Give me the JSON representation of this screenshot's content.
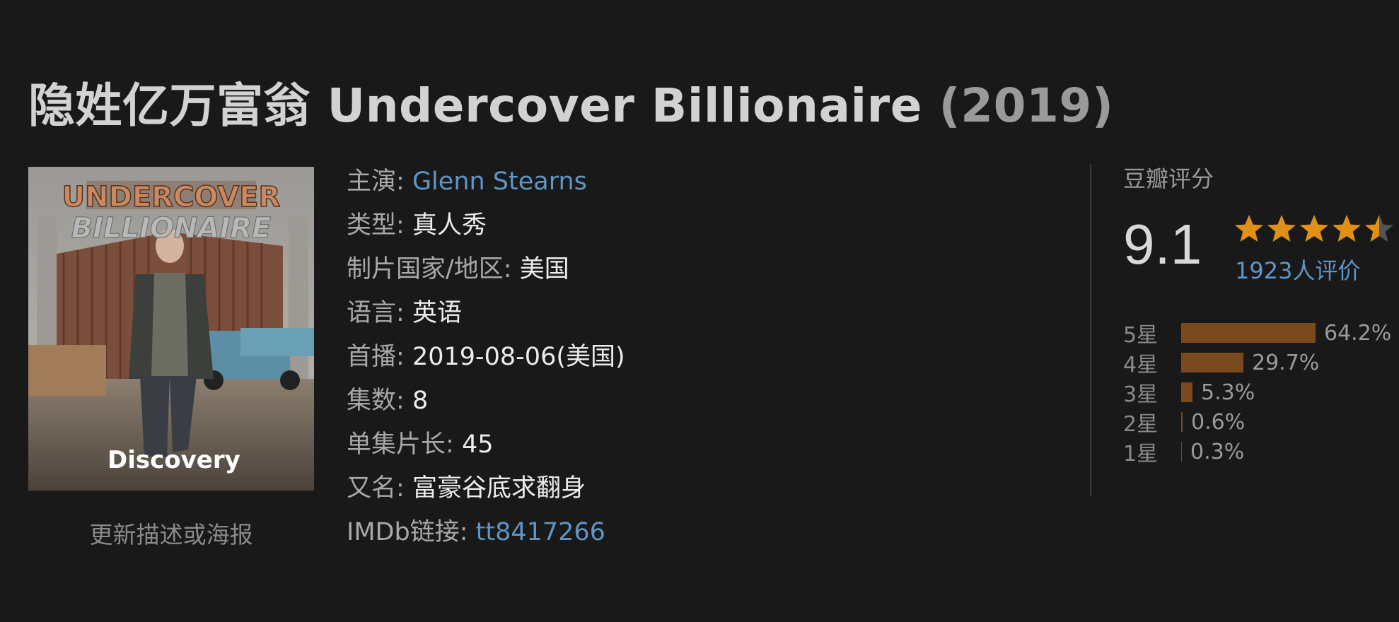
{
  "title": {
    "main": "隐姓亿万富翁 Undercover Billionaire",
    "year": "(2019)"
  },
  "poster": {
    "title_line1": "UNDERCOVER",
    "title_line2": "BILLIONAIRE",
    "brand": "Discovery"
  },
  "update_link": "更新描述或海报",
  "info": {
    "cast_label": "主演:",
    "cast_value": "Glenn Stearns",
    "genre_label": "类型:",
    "genre_value": "真人秀",
    "country_label": "制片国家/地区:",
    "country_value": "美国",
    "language_label": "语言:",
    "language_value": "英语",
    "premiere_label": "首播:",
    "premiere_value": "2019-08-06(美国)",
    "episodes_label": "集数:",
    "episodes_value": "8",
    "runtime_label": "单集片长:",
    "runtime_value": "45",
    "aka_label": "又名:",
    "aka_value": "富豪谷底求翻身",
    "imdb_label": "IMDb链接:",
    "imdb_value": "tt8417266"
  },
  "rating": {
    "label": "豆瓣评分",
    "score": "9.1",
    "stars": 4.5,
    "votes": "1923人评价",
    "star_color": "#e09015",
    "bar_color": "#7a4a1f",
    "link_color": "#5f95c6",
    "distribution": [
      {
        "label": "5星",
        "percent": 64.2,
        "text": "64.2%"
      },
      {
        "label": "4星",
        "percent": 29.7,
        "text": "29.7%"
      },
      {
        "label": "3星",
        "percent": 5.3,
        "text": "5.3%"
      },
      {
        "label": "2星",
        "percent": 0.6,
        "text": "0.6%"
      },
      {
        "label": "1星",
        "percent": 0.3,
        "text": "0.3%"
      }
    ]
  }
}
